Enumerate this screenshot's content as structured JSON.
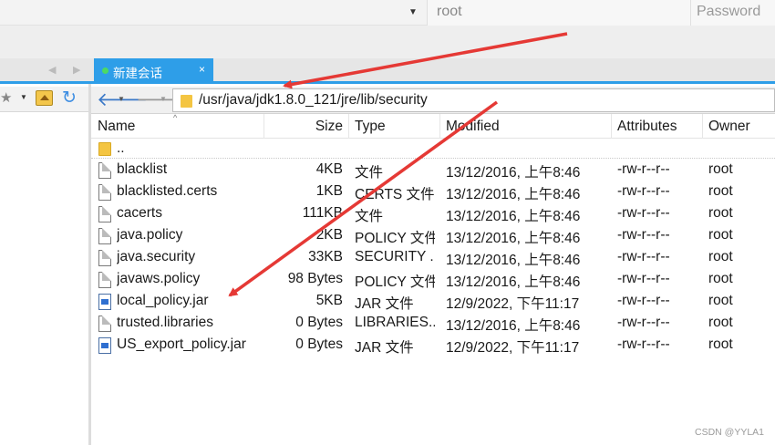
{
  "connection": {
    "username": "root",
    "password_placeholder": "Password"
  },
  "tab": {
    "label": "新建会话",
    "close_glyph": "×"
  },
  "path": "/usr/java/jdk1.8.0_121/jre/lib/security",
  "columns": {
    "name": "Name",
    "size": "Size",
    "type": "Type",
    "modified": "Modified",
    "attributes": "Attributes",
    "owner": "Owner"
  },
  "parent_dir": "..",
  "files": [
    {
      "name": "blacklist",
      "icon": "file-icon",
      "size": "4KB",
      "type": "文件",
      "modified": "13/12/2016, 上午8:46",
      "attributes": "-rw-r--r--",
      "owner": "root"
    },
    {
      "name": "blacklisted.certs",
      "icon": "file-icon",
      "size": "1KB",
      "type": "CERTS 文件",
      "modified": "13/12/2016, 上午8:46",
      "attributes": "-rw-r--r--",
      "owner": "root"
    },
    {
      "name": "cacerts",
      "icon": "file-icon",
      "size": "111KB",
      "type": "文件",
      "modified": "13/12/2016, 上午8:46",
      "attributes": "-rw-r--r--",
      "owner": "root"
    },
    {
      "name": "java.policy",
      "icon": "file-icon",
      "size": "2KB",
      "type": "POLICY 文件",
      "modified": "13/12/2016, 上午8:46",
      "attributes": "-rw-r--r--",
      "owner": "root"
    },
    {
      "name": "java.security",
      "icon": "file-icon",
      "size": "33KB",
      "type": "SECURITY ...",
      "modified": "13/12/2016, 上午8:46",
      "attributes": "-rw-r--r--",
      "owner": "root"
    },
    {
      "name": "javaws.policy",
      "icon": "file-icon",
      "size": "98 Bytes",
      "type": "POLICY 文件",
      "modified": "13/12/2016, 上午8:46",
      "attributes": "-rw-r--r--",
      "owner": "root"
    },
    {
      "name": "local_policy.jar",
      "icon": "jar-icon",
      "size": "5KB",
      "type": "JAR 文件",
      "modified": "12/9/2022, 下午11:17",
      "attributes": "-rw-r--r--",
      "owner": "root"
    },
    {
      "name": "trusted.libraries",
      "icon": "file-icon",
      "size": "0 Bytes",
      "type": "LIBRARIES...",
      "modified": "13/12/2016, 上午8:46",
      "attributes": "-rw-r--r--",
      "owner": "root"
    },
    {
      "name": "US_export_policy.jar",
      "icon": "jar-icon",
      "size": "0 Bytes",
      "type": "JAR 文件",
      "modified": "12/9/2022, 下午11:17",
      "attributes": "-rw-r--r--",
      "owner": "root"
    }
  ],
  "colors": {
    "tab_accent": "#2e9ee8",
    "annotation_arrow": "#e53935"
  },
  "watermark": "CSDN @YYLA1"
}
